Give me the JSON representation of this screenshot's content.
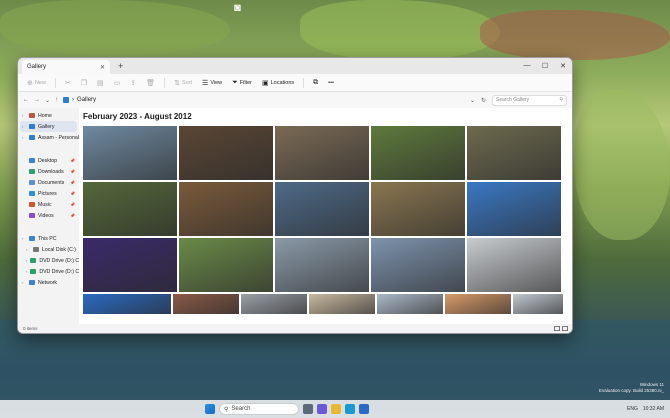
{
  "window": {
    "tab_title": "Gallery",
    "tab_close": "✕",
    "tab_add": "+",
    "controls": [
      "—",
      "☐",
      "✕"
    ]
  },
  "toolbar": {
    "new_label": "New",
    "sort_label": "Sort",
    "view_label": "View",
    "filter_label": "Filter",
    "locations_label": "Locations",
    "more_label": "•••"
  },
  "address": {
    "crumb": "Gallery",
    "search_placeholder": "Search Gallery"
  },
  "sidebar": {
    "top": [
      {
        "label": "Home",
        "icon": "home-icon",
        "color": "#c0564a"
      },
      {
        "label": "Gallery",
        "icon": "gallery-icon",
        "color": "#2a7fd4"
      },
      {
        "label": "Assam - Personal",
        "icon": "onedrive-icon",
        "color": "#2a7fd4"
      }
    ],
    "pinned": [
      {
        "label": "Desktop",
        "icon": "desktop-icon",
        "color": "#3b82d6"
      },
      {
        "label": "Downloads",
        "icon": "downloads-icon",
        "color": "#2aa06b"
      },
      {
        "label": "Documents",
        "icon": "documents-icon",
        "color": "#5a8fd6"
      },
      {
        "label": "Pictures",
        "icon": "pictures-icon",
        "color": "#2a8fd4"
      },
      {
        "label": "Music",
        "icon": "music-icon",
        "color": "#d4552a"
      },
      {
        "label": "Videos",
        "icon": "videos-icon",
        "color": "#8a4ad6"
      }
    ],
    "drives": [
      {
        "label": "This PC",
        "icon": "pc-icon",
        "color": "#3b82d6"
      },
      {
        "label": "Local Disk (C:)",
        "icon": "disk-icon",
        "color": "#777777"
      },
      {
        "label": "DVD Drive (D:) CC",
        "icon": "dvd-icon",
        "color": "#2aa06b"
      },
      {
        "label": "DVD Drive (D:) CCC",
        "icon": "dvd-icon",
        "color": "#2aa06b"
      },
      {
        "label": "Network",
        "icon": "network-icon",
        "color": "#3b82d6"
      }
    ]
  },
  "gallery": {
    "title": "February 2023 - August 2012",
    "rows": [
      {
        "photos": [
          {
            "w": 94,
            "color": "#6f8aa0"
          },
          {
            "w": 94,
            "color": "#5a4634"
          },
          {
            "w": 94,
            "color": "#7a6a55"
          },
          {
            "w": 94,
            "color": "#5e7a3c"
          },
          {
            "w": 94,
            "color": "#6d6a4e"
          }
        ]
      },
      {
        "photos": [
          {
            "w": 94,
            "color": "#55683a"
          },
          {
            "w": 94,
            "color": "#7a5a3a"
          },
          {
            "w": 94,
            "color": "#4e6a88"
          },
          {
            "w": 94,
            "color": "#8a7650"
          },
          {
            "w": 94,
            "color": "#3a78c4"
          }
        ]
      },
      {
        "photos": [
          {
            "w": 94,
            "color": "#3a2a6a"
          },
          {
            "w": 94,
            "color": "#6a8a48"
          },
          {
            "w": 94,
            "color": "#8a9aa8"
          },
          {
            "w": 94,
            "color": "#7d93ad"
          },
          {
            "w": 94,
            "color": "#c8cccf"
          }
        ]
      },
      {
        "photos": [
          {
            "w": 88,
            "color": "#2a6ac4"
          },
          {
            "w": 66,
            "color": "#8a5a48"
          },
          {
            "w": 66,
            "color": "#9aa0a8"
          },
          {
            "w": 66,
            "color": "#c8b8a0"
          },
          {
            "w": 66,
            "color": "#aab8c8"
          },
          {
            "w": 66,
            "color": "#d89a6a"
          },
          {
            "w": 50,
            "color": "#c0c8d0"
          }
        ]
      }
    ]
  },
  "status": {
    "items": "0 items"
  },
  "taskbar": {
    "search_label": "Search",
    "lang": "ENG",
    "time": "10:32 AM"
  },
  "watermark": {
    "line1": "Windows 11",
    "line2": "Evaluation copy. Build 25380.ni_"
  }
}
